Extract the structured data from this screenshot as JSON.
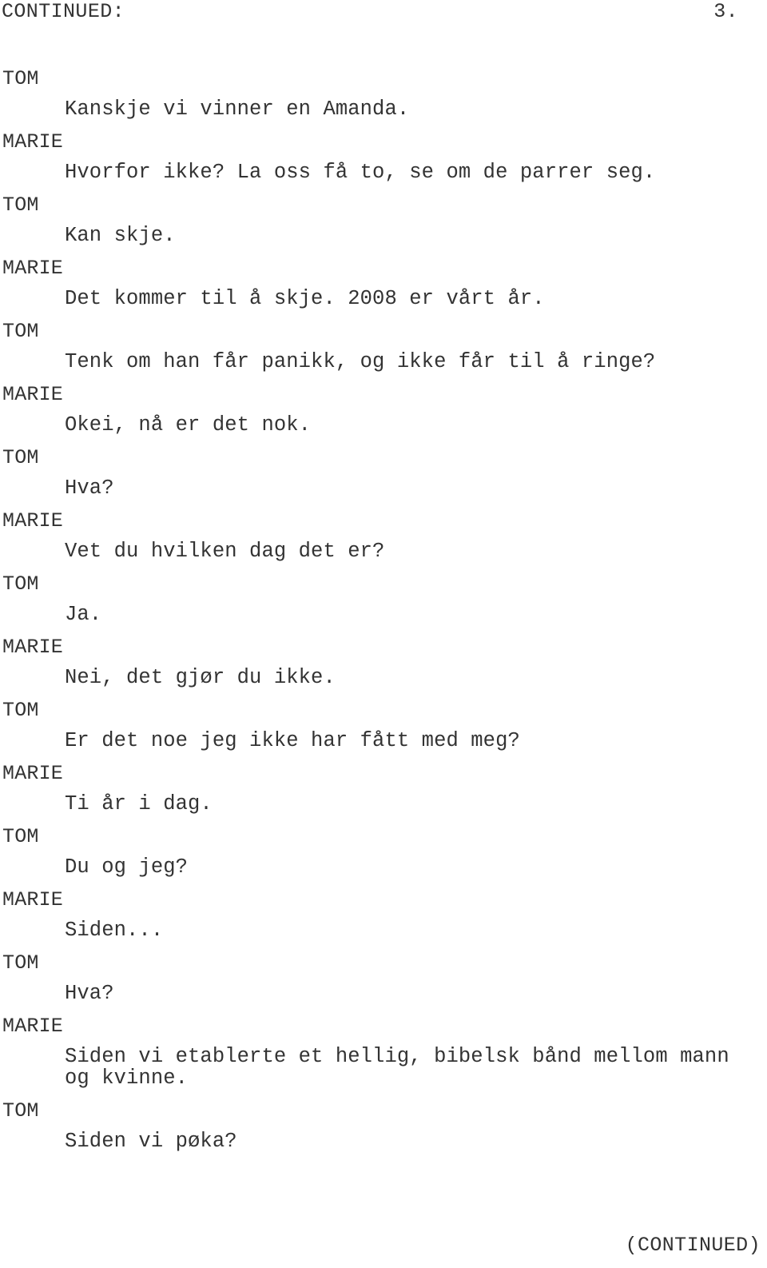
{
  "page": {
    "background_color": "#ffffff",
    "text_color": "#333333"
  },
  "header": {
    "continued_label": "CONTINUED:",
    "page_number": "3."
  },
  "footer": {
    "continued_label": "(CONTINUED)"
  },
  "script": {
    "blocks": [
      {
        "character": "TOM",
        "dialogue": "Kanskje vi vinner en Amanda."
      },
      {
        "character": "MARIE",
        "dialogue": "Hvorfor ikke? La oss få to, se om de parrer seg."
      },
      {
        "character": "TOM",
        "dialogue": "Kan skje."
      },
      {
        "character": "MARIE",
        "dialogue": "Det kommer til å skje. 2008 er vårt år."
      },
      {
        "character": "TOM",
        "dialogue": "Tenk om han får panikk, og ikke får til å ringe?"
      },
      {
        "character": "MARIE",
        "dialogue": "Okei, nå er det nok."
      },
      {
        "character": "TOM",
        "dialogue": "Hva?"
      },
      {
        "character": "MARIE",
        "dialogue": "Vet du hvilken dag det er?"
      },
      {
        "character": "TOM",
        "dialogue": "Ja."
      },
      {
        "character": "MARIE",
        "dialogue": "Nei, det gjør du ikke."
      },
      {
        "character": "TOM",
        "dialogue": "Er det noe jeg ikke har fått med meg?"
      },
      {
        "character": "MARIE",
        "dialogue": "Ti år i dag."
      },
      {
        "character": "TOM",
        "dialogue": "Du og jeg?"
      },
      {
        "character": "MARIE",
        "dialogue": "Siden..."
      },
      {
        "character": "TOM",
        "dialogue": "Hva?"
      },
      {
        "character": "MARIE",
        "dialogue": "Siden vi etablerte et hellig, bibelsk bånd mellom mann og kvinne."
      },
      {
        "character": "TOM",
        "dialogue": "Siden vi pøka?"
      }
    ]
  }
}
